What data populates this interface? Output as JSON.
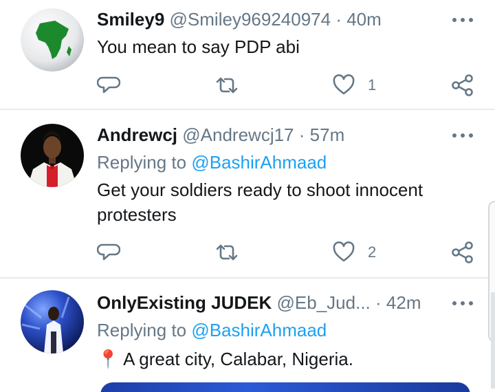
{
  "colors": {
    "text": "#14171a",
    "secondary": "#657786",
    "link": "#1da1f2",
    "divider": "#e6ecf0"
  },
  "tweets": [
    {
      "name": "Smiley9",
      "handle": "@Smiley969240974",
      "dot": "·",
      "time": "40m",
      "text": "You mean to say PDP abi",
      "reply_count": "",
      "retweet_count": "",
      "like_count": "1",
      "avatar": "globe-africa-avatar"
    },
    {
      "name": "Andrewcj",
      "handle": "@Andrewcj17",
      "dot": "·",
      "time": "57m",
      "replying_label": "Replying to",
      "replying_to": "@BashirAhmaad",
      "text": "Get your soldiers ready to shoot innocent protesters",
      "reply_count": "",
      "retweet_count": "",
      "like_count": "2",
      "avatar": "man-in-white-suit-avatar"
    },
    {
      "name": "OnlyExisting JUDEK",
      "handle": "@Eb_Jud...",
      "dot": "·",
      "time": "42m",
      "replying_label": "Replying to",
      "replying_to": "@BashirAhmaad",
      "location_icon": "📍",
      "text": "A great city, Calabar, Nigeria.",
      "avatar": "person-blue-light-avatar"
    }
  ],
  "icons": [
    "more-icon",
    "reply-icon",
    "retweet-icon",
    "like-icon",
    "share-icon",
    "location-pin-icon"
  ]
}
